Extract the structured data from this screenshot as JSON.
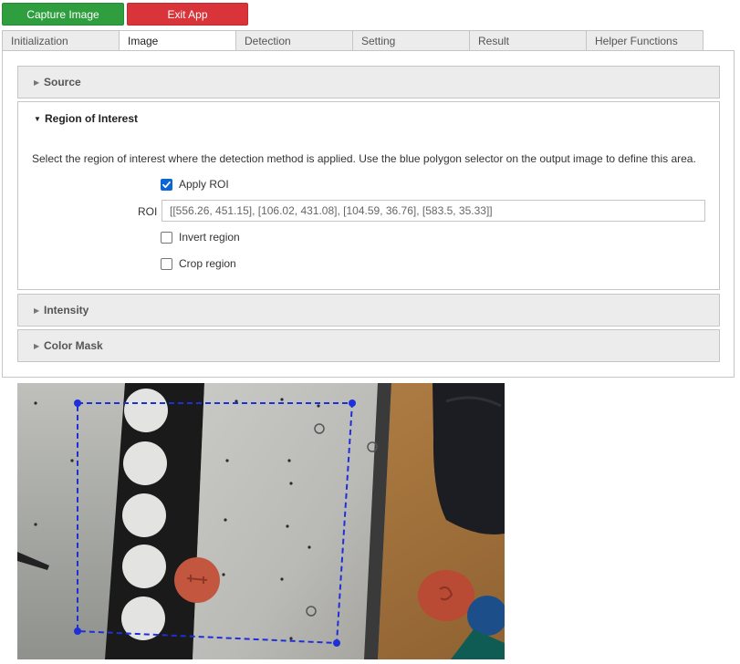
{
  "toolbar": {
    "capture_label": "Capture Image",
    "exit_label": "Exit App",
    "capture_color": "#2f9e3f",
    "exit_color": "#d9343a"
  },
  "tabs": [
    {
      "label": "Initialization",
      "active": false
    },
    {
      "label": "Image",
      "active": true
    },
    {
      "label": "Detection",
      "active": false
    },
    {
      "label": "Setting",
      "active": false
    },
    {
      "label": "Result",
      "active": false
    },
    {
      "label": "Helper Functions",
      "active": false
    }
  ],
  "sections": {
    "source": {
      "title": "Source",
      "expanded": false
    },
    "roi": {
      "title": "Region of Interest",
      "expanded": true,
      "description": "Select the region of interest where the detection method is applied. Use the blue polygon selector on the output image to define this area.",
      "apply_roi_label": "Apply ROI",
      "apply_roi_checked": true,
      "roi_label": "ROI",
      "roi_value": "[[556.26, 451.15], [106.02, 431.08], [104.59, 36.76], [583.5, 35.33]]",
      "invert_label": "Invert region",
      "invert_checked": false,
      "crop_label": "Crop region",
      "crop_checked": false
    },
    "intensity": {
      "title": "Intensity",
      "expanded": false
    },
    "color_mask": {
      "title": "Color Mask",
      "expanded": false
    }
  },
  "accent_color": "#0a66d4",
  "roi_polygon_color": "#1f2fd8"
}
